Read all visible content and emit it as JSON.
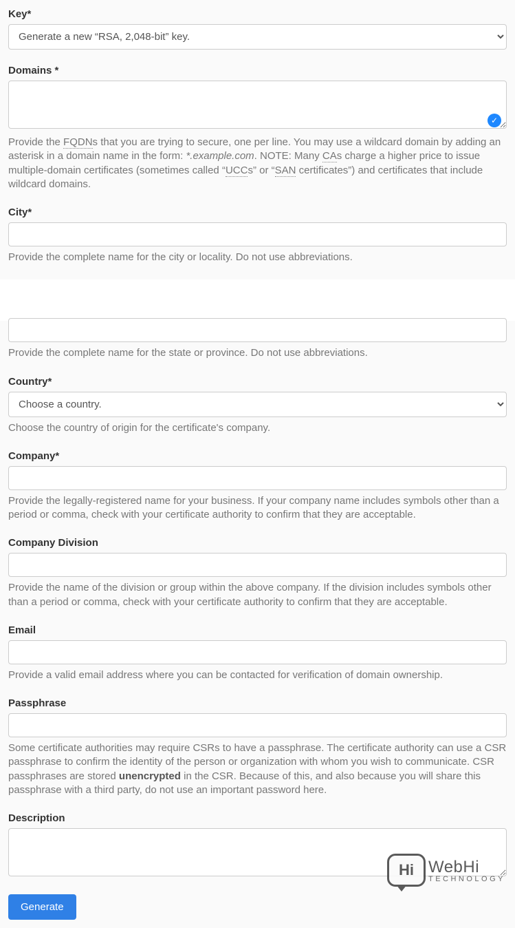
{
  "key": {
    "label": "Key*",
    "selected": "Generate a new “RSA, 2,048-bit” key."
  },
  "domains": {
    "label": "Domains *",
    "value": "",
    "help_pre": "Provide the ",
    "abbr1": "FQDN",
    "help_mid1": "s that you are trying to secure, one per line. You may use a wildcard domain by adding an asterisk in a domain name in the form: ",
    "example": "*.example.com",
    "help_mid2": ". NOTE: Many ",
    "abbr2": "CA",
    "help_mid3": "s charge a higher price to issue multiple-domain certificates (sometimes called “",
    "abbr3": "UCC",
    "help_mid4": "s” or “",
    "abbr4": "SAN",
    "help_post": " certificates”) and certificates that include wildcard domains."
  },
  "city": {
    "label": "City*",
    "value": "",
    "help": "Provide the complete name for the city or locality. Do not use abbreviations."
  },
  "state": {
    "value": "",
    "help": "Provide the complete name for the state or province. Do not use abbreviations."
  },
  "country": {
    "label": "Country*",
    "selected": "Choose a country.",
    "help": "Choose the country of origin for the certificate's company."
  },
  "company": {
    "label": "Company*",
    "value": "",
    "help": "Provide the legally-registered name for your business. If your company name includes symbols other than a period or comma, check with your certificate authority to confirm that they are acceptable."
  },
  "division": {
    "label": "Company Division",
    "value": "",
    "help": "Provide the name of the division or group within the above company. If the division includes symbols other than a period or comma, check with your certificate authority to confirm that they are acceptable."
  },
  "email": {
    "label": "Email",
    "value": "",
    "help": "Provide a valid email address where you can be contacted for verification of domain ownership."
  },
  "passphrase": {
    "label": "Passphrase",
    "value": "",
    "help_pre": "Some certificate authorities may require CSRs to have a passphrase. The certificate authority can use a CSR passphrase to confirm the identity of the person or organization with whom you wish to communicate. CSR passphrases are stored ",
    "strong": "unencrypted",
    "help_post": " in the CSR. Because of this, and also because you will share this passphrase with a third party, do not use an important password here."
  },
  "description": {
    "label": "Description",
    "value": ""
  },
  "submit": {
    "label": "Generate"
  },
  "watermark": {
    "brand_hi": "Hi",
    "brand_text": "WebHi",
    "brand_sub": "TECHNOLOGY"
  }
}
